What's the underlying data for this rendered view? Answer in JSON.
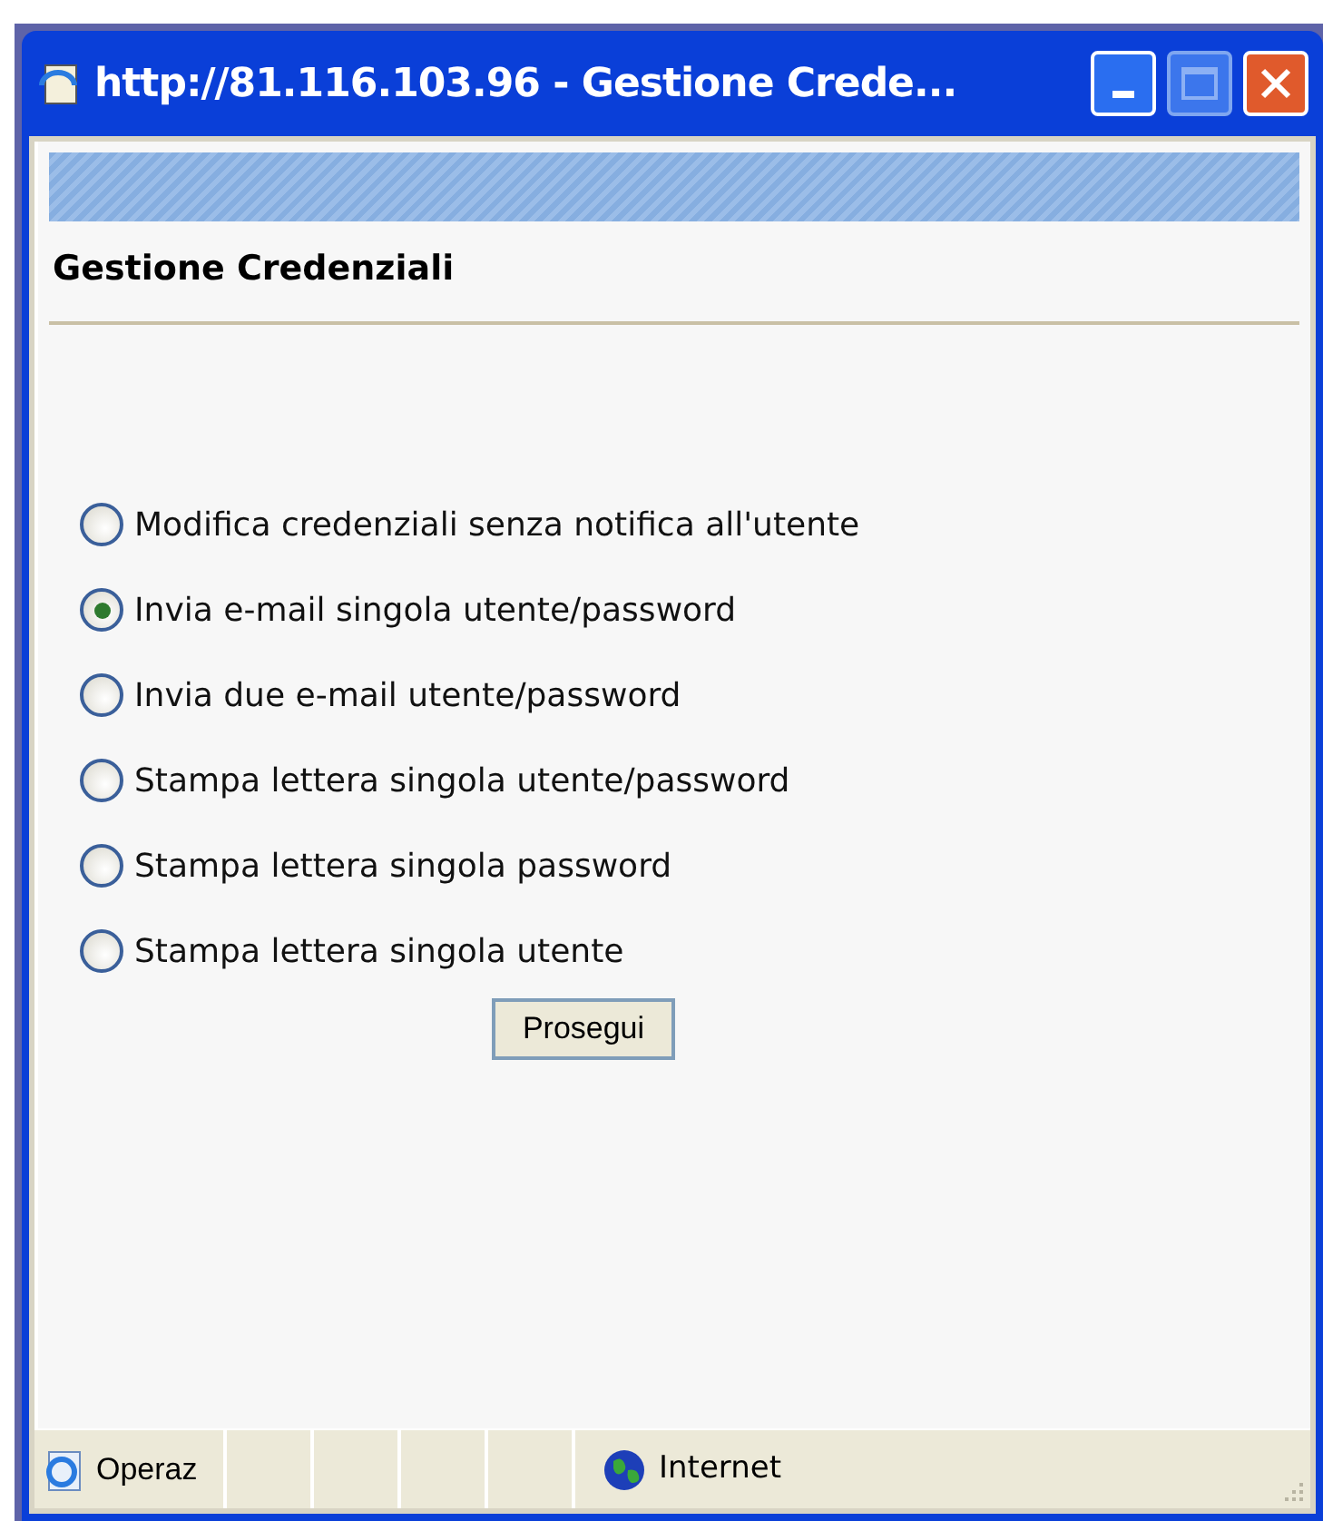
{
  "window": {
    "title": "http://81.116.103.96 - Gestione Crede..."
  },
  "page": {
    "heading": "Gestione Credenziali"
  },
  "options": [
    {
      "label": "Modifica credenziali senza notifica all'utente",
      "selected": false
    },
    {
      "label": "Invia e-mail singola utente/password",
      "selected": true
    },
    {
      "label": "Invia due e-mail utente/password",
      "selected": false
    },
    {
      "label": "Stampa lettera singola utente/password",
      "selected": false
    },
    {
      "label": "Stampa lettera singola password",
      "selected": false
    },
    {
      "label": "Stampa lettera singola utente",
      "selected": false
    }
  ],
  "button": "Prosegui",
  "status_bar": {
    "status": "Operaz",
    "zone": "Internet"
  }
}
